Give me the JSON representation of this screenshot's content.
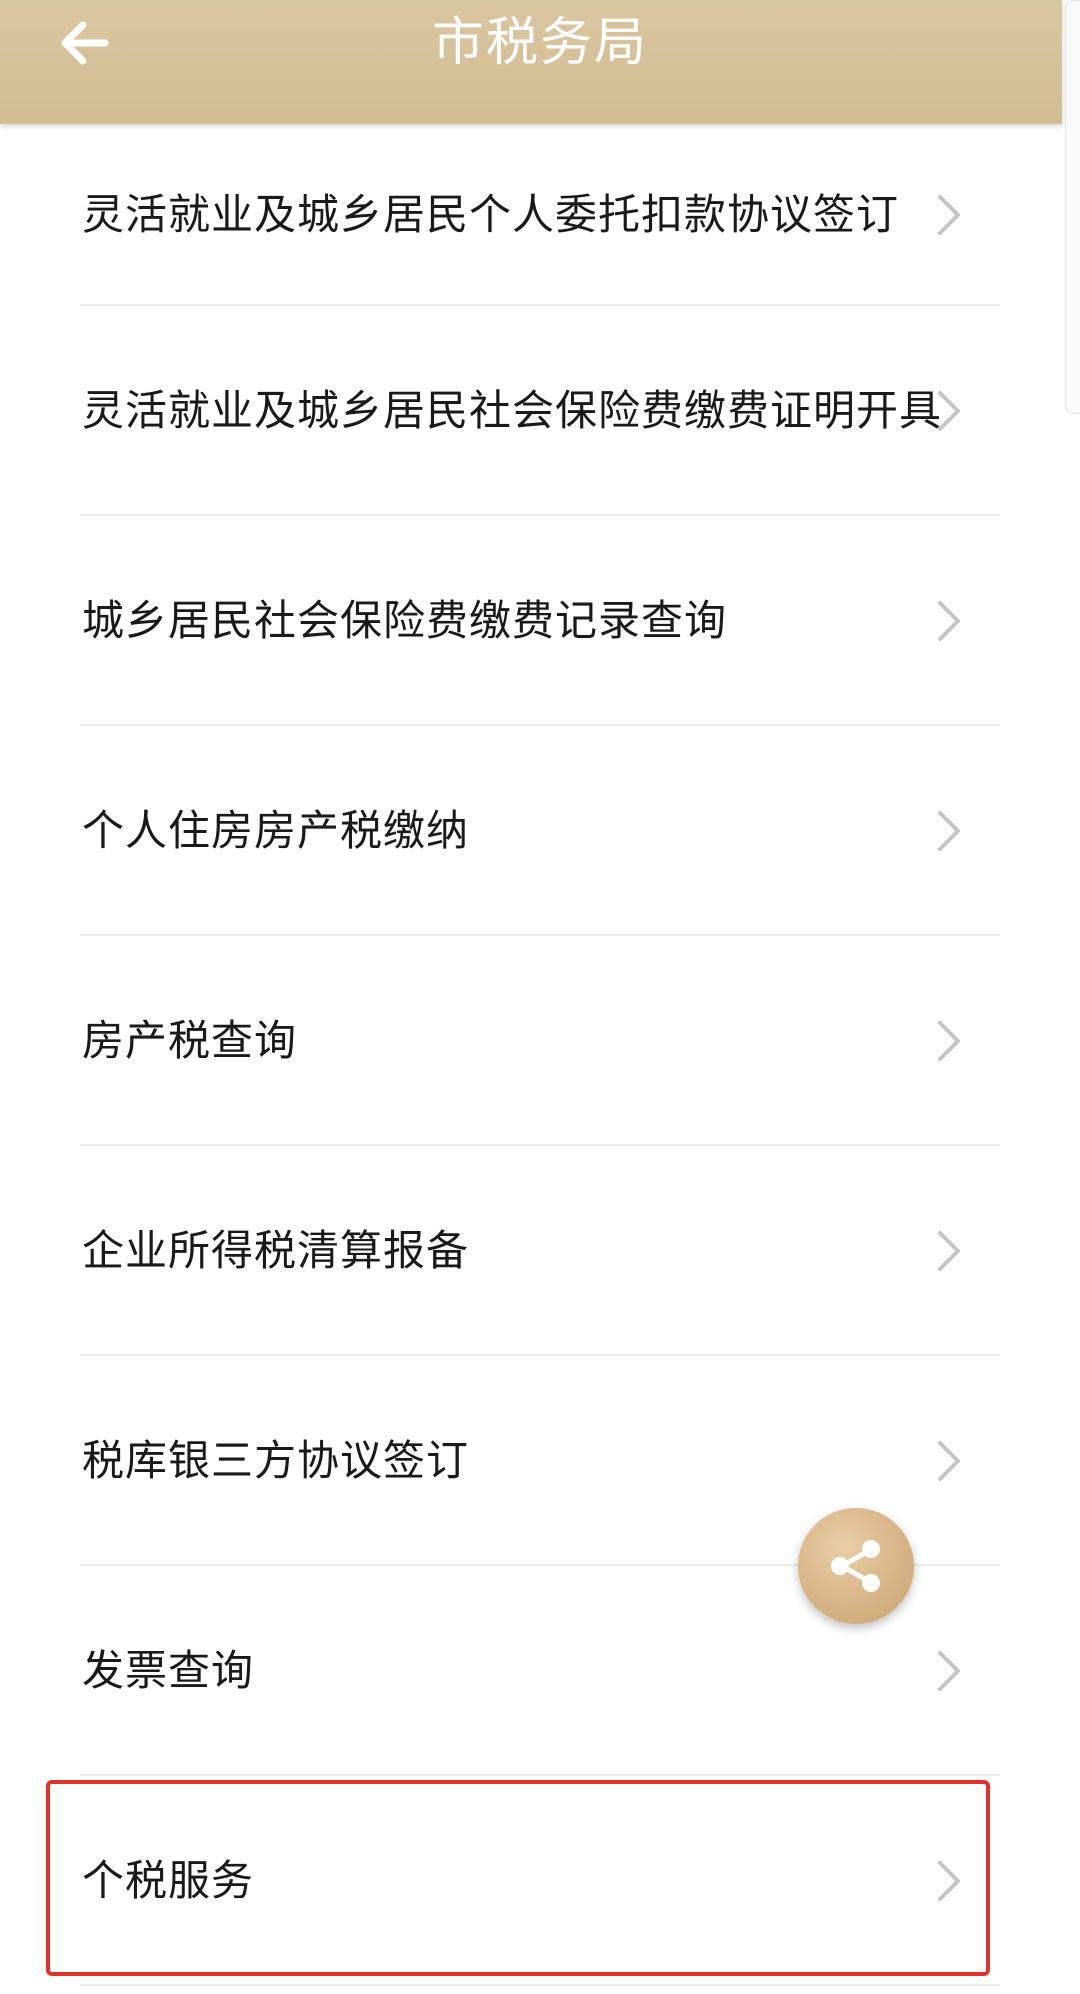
{
  "header": {
    "title": "市税务局",
    "back_icon": "arrow-left-icon",
    "background_color": "#d6c299",
    "title_color": "#ffffff"
  },
  "list": {
    "chevron_icon": "chevron-right-icon",
    "items": [
      {
        "label": "灵活就业及城乡居民个人委托扣款协议签订"
      },
      {
        "label": "灵活就业及城乡居民社会保险费缴费证明开具"
      },
      {
        "label": "城乡居民社会保险费缴费记录查询"
      },
      {
        "label": "个人住房房产税缴纳"
      },
      {
        "label": "房产税查询"
      },
      {
        "label": "企业所得税清算报备"
      },
      {
        "label": "税库银三方协议签订"
      },
      {
        "label": "发票查询"
      },
      {
        "label": "个税服务"
      }
    ]
  },
  "share_button": {
    "icon": "share-icon",
    "color": "#d7b485"
  },
  "highlight": {
    "color": "#e0322c",
    "target": "个税服务"
  }
}
